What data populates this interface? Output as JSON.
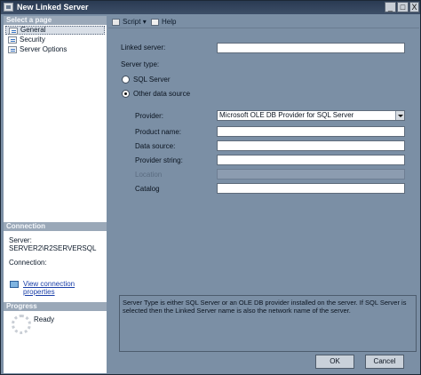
{
  "window": {
    "title": "New Linked Server",
    "controls": {
      "minimize": "_",
      "maximize": "□",
      "close": "X"
    }
  },
  "sidebar": {
    "select_page_header": "Select a page",
    "pages": [
      {
        "label": "General",
        "icon": "page-icon",
        "selected": true
      },
      {
        "label": "Security",
        "icon": "page-icon",
        "selected": false
      },
      {
        "label": "Server Options",
        "icon": "page-icon",
        "selected": false
      }
    ],
    "connection_header": "Connection",
    "server_label": "Server:",
    "server_value": "SERVER2\\R2SERVERSQL",
    "connection_label": "Connection:",
    "view_connection_link": "View connection properties",
    "progress_header": "Progress",
    "progress_status": "Ready"
  },
  "toolbar": {
    "script_label": "Script",
    "script_icon": "script-icon",
    "help_label": "Help",
    "help_icon": "help-icon"
  },
  "form": {
    "linked_server_label": "Linked server:",
    "linked_server_value": "",
    "server_type_label": "Server type:",
    "sql_server_option": "SQL Server",
    "other_source_option": "Other data source",
    "selected_server_type": "Other data source",
    "provider_label": "Provider:",
    "provider_value": "Microsoft OLE DB Provider for SQL Server",
    "product_name_label": "Product name:",
    "data_source_label": "Data source:",
    "provider_string_label": "Provider string:",
    "location_label": "Location",
    "catalog_label": "Catalog"
  },
  "description": "Server Type is either SQL Server or an OLE DB provider installed on the server. If SQL Server is selected then the Linked Server name is also the network name of the server.",
  "buttons": {
    "ok": "OK",
    "cancel": "Cancel"
  },
  "colors": {
    "dialog_background": "#7b8fa5",
    "title_bar": "#2a3a52",
    "link": "#1a3fa8"
  }
}
